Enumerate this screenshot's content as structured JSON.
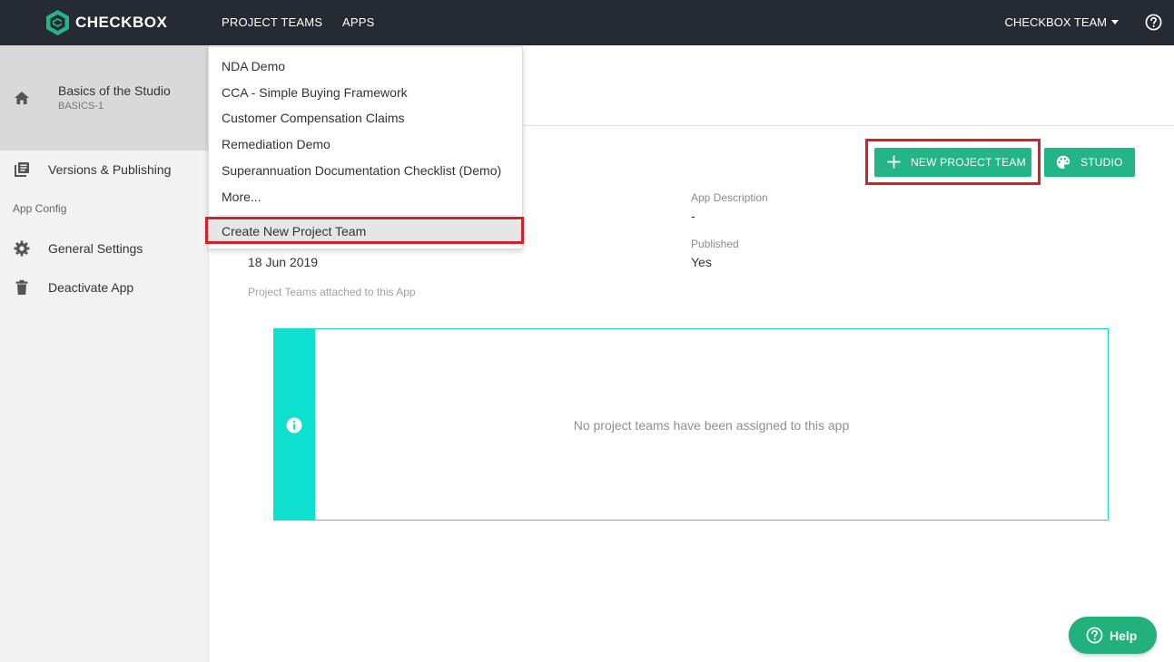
{
  "topbar": {
    "brand": "CHECKBOX",
    "nav": [
      "PROJECT TEAMS",
      "APPS"
    ],
    "team_menu": "CHECKBOX TEAM"
  },
  "sidebar": {
    "app_title": "Basics of the Studio",
    "app_code": "BASICS-1",
    "items": [
      {
        "label": "Versions & Publishing",
        "icon": "library-books-icon"
      },
      {
        "label": "General Settings",
        "icon": "gear-icon"
      },
      {
        "label": "Deactivate App",
        "icon": "trash-icon"
      }
    ],
    "section_label": "App Config"
  },
  "dropdown": {
    "items": [
      "NDA Demo",
      "CCA - Simple Buying Framework",
      "Customer Compensation Claims",
      "Remediation Demo",
      "Superannuation Documentation Checklist (Demo)",
      "More..."
    ],
    "create_label": "Create New Project Team"
  },
  "actions": {
    "new_project_team": "NEW PROJECT TEAM",
    "studio": "STUDIO"
  },
  "details": {
    "date_value": "18 Jun 2019",
    "app_description_label": "App Description",
    "app_description_value": "-",
    "published_label": "Published",
    "published_value": "Yes",
    "project_teams_label": "Project Teams attached to this App"
  },
  "empty_state": {
    "message": "No project teams have been assigned to this app"
  },
  "help": {
    "label": "Help"
  },
  "colors": {
    "topbar": "#262a33",
    "accent_green": "#23b487",
    "info_teal": "#0ee0cf",
    "highlight_red": "#d71f27"
  }
}
